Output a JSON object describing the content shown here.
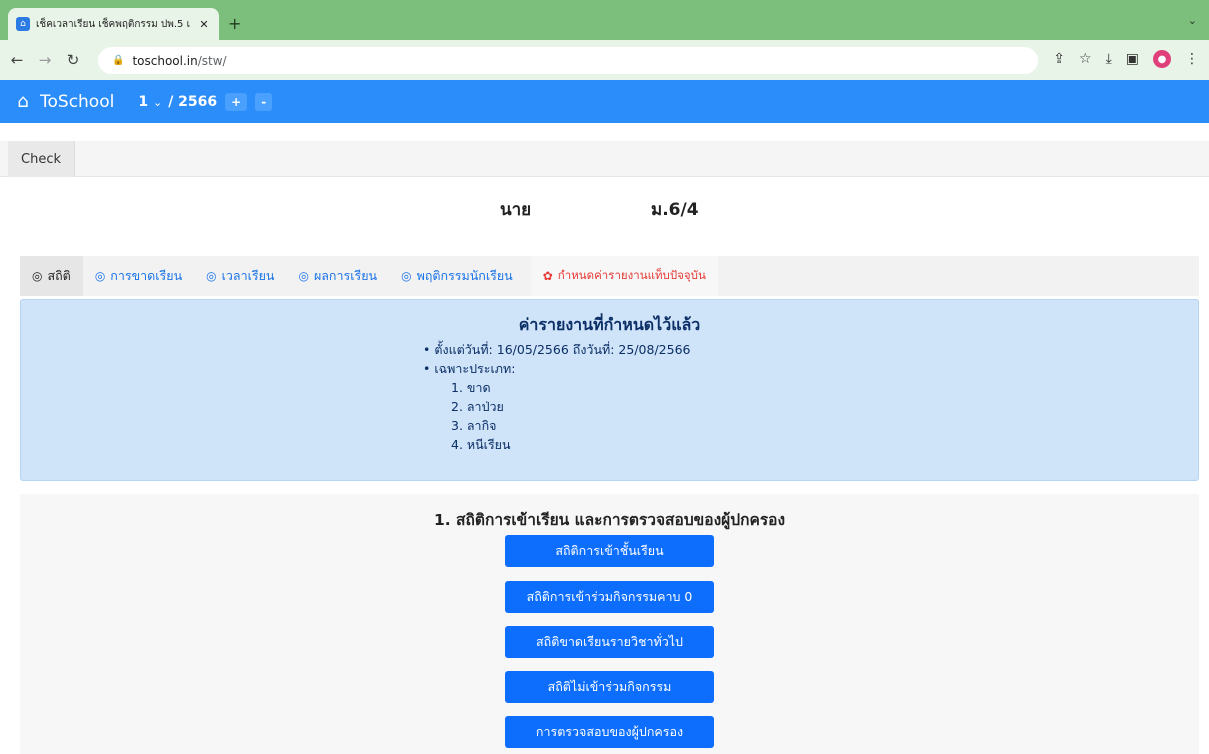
{
  "browser": {
    "tab_title": "เช็คเวลาเรียน เช็คพฤติกรรม ปพ.5 เ",
    "url_host": "toschool.in",
    "url_path": "/stw/"
  },
  "app": {
    "brand": "ToSchool",
    "term": "1",
    "year": "/ 2566",
    "plus_label": "+",
    "minus_label": "-"
  },
  "checkbar": {
    "check_label": "Check"
  },
  "student": {
    "title_prefix": "นาย",
    "class": "ม.6/4"
  },
  "tabs": [
    {
      "label": "สถิติ",
      "active": true
    },
    {
      "label": "การขาดเรียน"
    },
    {
      "label": "เวลาเรียน"
    },
    {
      "label": "ผลการเรียน"
    },
    {
      "label": "พฤติกรรมนักเรียน"
    },
    {
      "label": "กำหนดค่ารายงานแท็บปัจจุบัน"
    }
  ],
  "report": {
    "heading": "ค่ารายงานที่กำหนดไว้แล้ว",
    "date_range": "ตั้งแต่วันที่: 16/05/2566 ถึงวันที่: 25/08/2566",
    "type_label": "เฉพาะประเภท:",
    "types": [
      "1. ขาด",
      "2. ลาป่วย",
      "3. ลากิจ",
      "4. หนีเรียน"
    ]
  },
  "stats": {
    "heading": "1. สถิติการเข้าเรียน และการตรวจสอบของผู้ปกครอง",
    "buttons": [
      "สถิติการเข้าชั้นเรียน",
      "สถิติการเข้าร่วมกิจกรรมคาบ 0",
      "สถิติขาดเรียนรายวิชาทั่วไป",
      "สถิติไม่เข้าร่วมกิจกรรม",
      "การตรวจสอบของผู้ปกครอง"
    ]
  }
}
